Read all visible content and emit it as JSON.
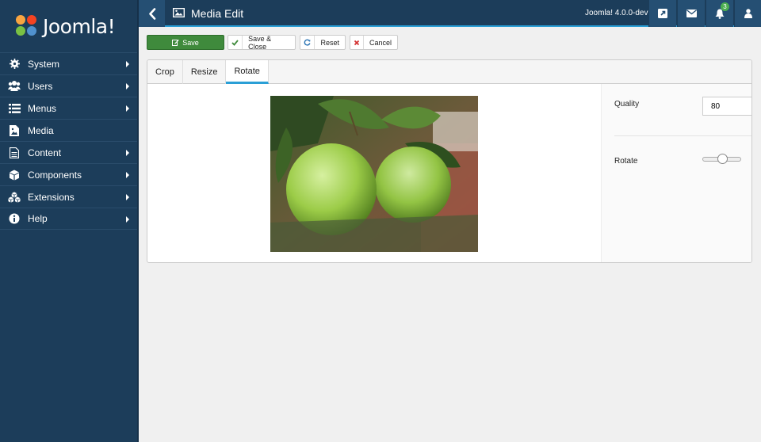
{
  "app": {
    "logo_text": "Joomla!",
    "version": "Joomla! 4.0.0-dev"
  },
  "sidebar": {
    "items": [
      {
        "label": "System",
        "icon": "gear-icon",
        "has_submenu": true
      },
      {
        "label": "Users",
        "icon": "users-icon",
        "has_submenu": true
      },
      {
        "label": "Menus",
        "icon": "list-icon",
        "has_submenu": true
      },
      {
        "label": "Media",
        "icon": "image-file-icon",
        "has_submenu": false
      },
      {
        "label": "Content",
        "icon": "document-icon",
        "has_submenu": true
      },
      {
        "label": "Components",
        "icon": "cube-icon",
        "has_submenu": true
      },
      {
        "label": "Extensions",
        "icon": "cubes-icon",
        "has_submenu": true
      },
      {
        "label": "Help",
        "icon": "info-icon",
        "has_submenu": true
      }
    ]
  },
  "header": {
    "title": "Media Edit",
    "notification_count": "3"
  },
  "toolbar": {
    "save_label": "Save",
    "save_close_label": "Save & Close",
    "reset_label": "Reset",
    "cancel_label": "Cancel"
  },
  "tabs": [
    {
      "label": "Crop",
      "active": false
    },
    {
      "label": "Resize",
      "active": false
    },
    {
      "label": "Rotate",
      "active": true
    }
  ],
  "settings": {
    "quality_label": "Quality",
    "quality_value": "80",
    "rotate_label": "Rotate",
    "rotate_fraction": 0.5
  },
  "colors": {
    "sidebar_bg": "#1c3d5a",
    "accent": "#2a9fd6",
    "save_green": "#3f8a3c",
    "badge_green": "#4caf50"
  }
}
